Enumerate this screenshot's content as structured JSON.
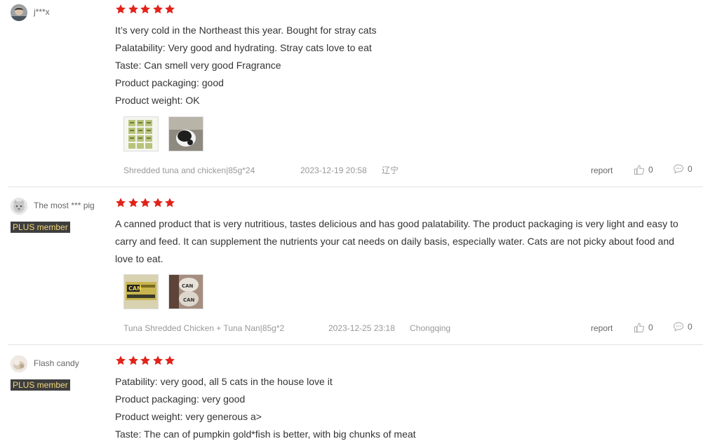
{
  "colors": {
    "star": "#e2231a",
    "plus_badge_bg": "#3e3e3e",
    "plus_badge_text": "#f5d67a",
    "meta_text": "#999999"
  },
  "actions": {
    "report_label": "report",
    "like_icon": "thumbs-up-icon",
    "comment_icon": "comment-icon"
  },
  "reviews": [
    {
      "username": "j***x",
      "plus_member": false,
      "rating": 5,
      "lines": [
        "It’s very cold in the Northeast this year. Bought for stray cats",
        "Palatability: Very good and hydrating. Stray cats love to eat",
        "Taste: Can smell very good Fragrance",
        "Product packaging: good",
        "Product weight: OK"
      ],
      "photo_count": 2,
      "variant": "Shredded tuna and chicken|85g*24",
      "date": "2023-12-19 20:58",
      "location": "辽宁",
      "likes": "0",
      "comments": "0"
    },
    {
      "username": "The most *** pig",
      "plus_member": true,
      "plus_label": "PLUS member",
      "rating": 5,
      "text": "A canned product that is very nutritious, tastes delicious and has good palatability. The product packaging is very light and easy to carry and feed. It can supplement the nutrients your cat needs on daily basis, especially water. Cats are not picky about food and love to eat.",
      "photo_count": 2,
      "variant": "Tuna Shredded Chicken + Tuna Nan|85g*2",
      "date": "2023-12-25 23:18",
      "location": "Chongqing",
      "likes": "0",
      "comments": "0"
    },
    {
      "username": "Flash candy",
      "plus_member": true,
      "plus_label": "PLUS member",
      "rating": 5,
      "lines": [
        "Patability: very good, all 5 cats in the house love it",
        "Product packaging: very good",
        "Product weight: very generous a>",
        "Taste: The can of pumpkin gold*fish is better, with big chunks of meat"
      ]
    }
  ]
}
